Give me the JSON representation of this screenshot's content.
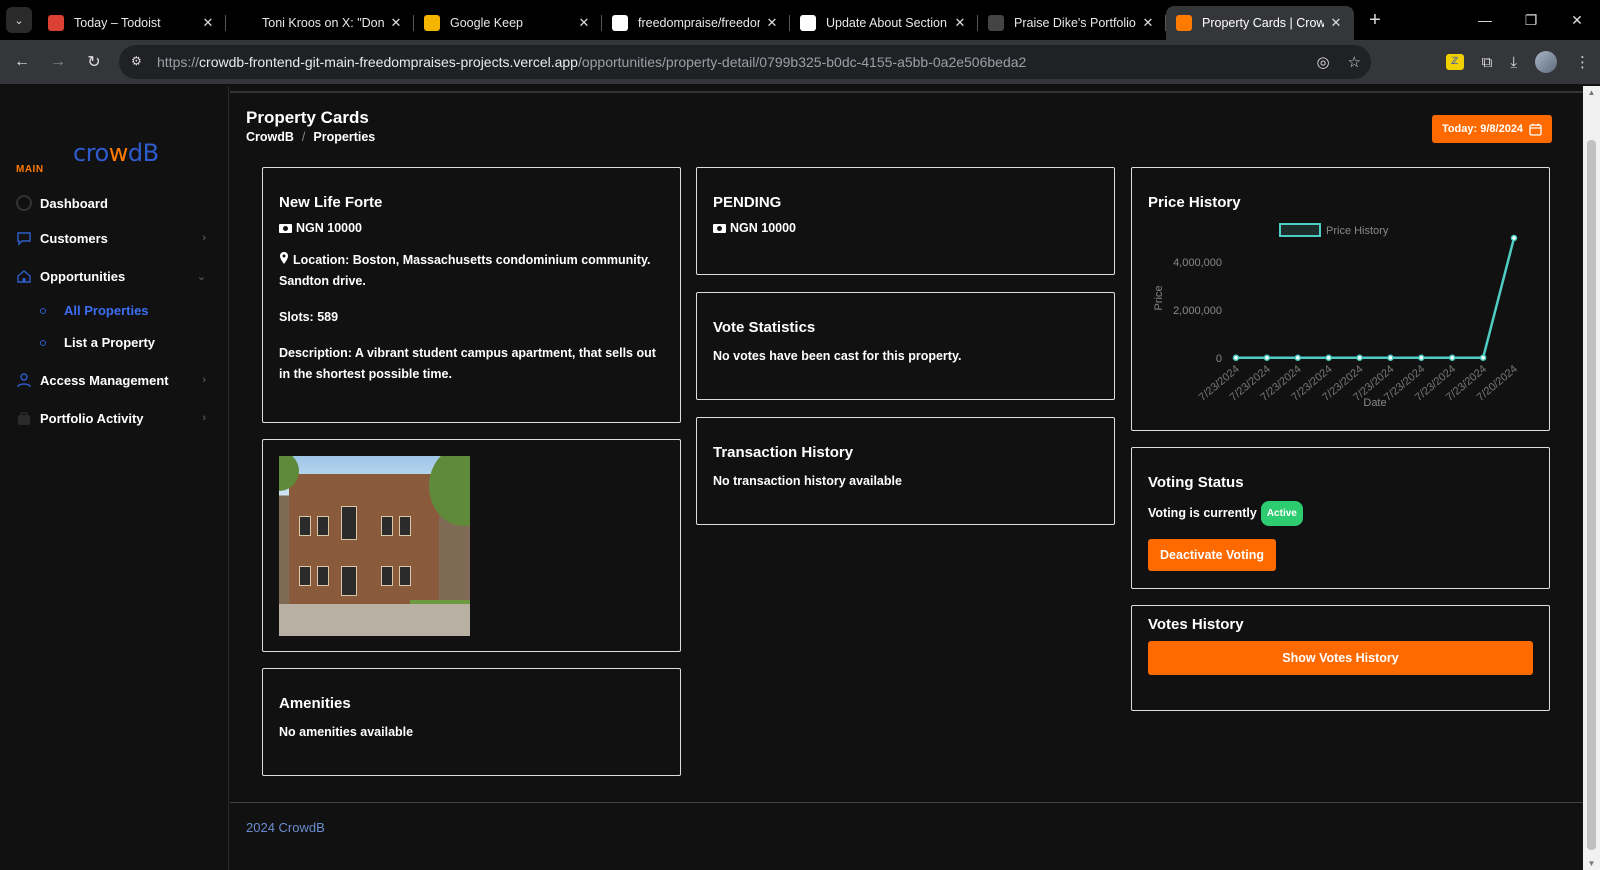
{
  "browser": {
    "tabs": [
      {
        "title": "Today – Todoist",
        "favicon_color": "#db4035",
        "favicon": "todoist-icon",
        "active": false
      },
      {
        "title": "Toni Kroos on X: \"Don't",
        "favicon_color": "#000000",
        "favicon": "x-icon",
        "active": false
      },
      {
        "title": "Google Keep",
        "favicon_color": "#f4b400",
        "favicon": "keep-icon",
        "active": false
      },
      {
        "title": "freedompraise/freedor",
        "favicon_color": "#ffffff",
        "favicon": "github-icon",
        "active": false
      },
      {
        "title": "Update About Section",
        "favicon_color": "#ffffff",
        "favicon": "chatgpt-icon",
        "active": false
      },
      {
        "title": "Praise Dike's Portfolio",
        "favicon_color": "#444444",
        "favicon": "portfolio-icon",
        "active": false
      },
      {
        "title": "Property Cards | Crowd",
        "favicon_color": "#ff7a00",
        "favicon": "crowdb-icon",
        "active": true
      }
    ],
    "url_prefix": "https://",
    "url_host": "crowdb-frontend-git-main-freedompraises-projects.vercel.app",
    "url_path": "/opportunities/property-detail/0799b325-b0dc-4155-a5bb-0a2e506beda2"
  },
  "sidebar": {
    "logo_prefix": "cro",
    "logo_w": "w",
    "logo_suffix": "dB",
    "section_label": "MAIN",
    "items": [
      {
        "label": "Dashboard",
        "icon": "dashboard-icon"
      },
      {
        "label": "Customers",
        "icon": "chat-icon"
      },
      {
        "label": "Opportunities",
        "icon": "home-icon"
      },
      {
        "label": "Access Management",
        "icon": "user-icon"
      },
      {
        "label": "Portfolio Activity",
        "icon": "bag-icon"
      }
    ],
    "sub_items": [
      {
        "label": "All Properties",
        "active": true
      },
      {
        "label": "List a Property",
        "active": false
      }
    ]
  },
  "header": {
    "title": "Property Cards",
    "breadcrumb": [
      "CrowdB",
      "Properties"
    ],
    "breadcrumb_sep": "/",
    "today_label": "Today: 9/8/2024"
  },
  "property": {
    "name": "New Life Forte",
    "price": "NGN 10000",
    "location": "Location: Boston, Massachusetts condominium community. Sandton drive.",
    "slots": "Slots: 589",
    "description": "Description: A vibrant student campus apartment, that sells out in the shortest possible time."
  },
  "amenities": {
    "title": "Amenities",
    "text": "No amenities available"
  },
  "status_card": {
    "status": "PENDING",
    "price": "NGN 10000"
  },
  "vote_statistics": {
    "title": "Vote Statistics",
    "text": "No votes have been cast for this property."
  },
  "transaction_history": {
    "title": "Transaction History",
    "text": "No transaction history available"
  },
  "price_history": {
    "title": "Price History"
  },
  "chart_data": {
    "type": "line",
    "legend": "Price History",
    "xlabel": "Date",
    "ylabel": "Price",
    "x": [
      "7/23/2024",
      "7/23/2024",
      "7/23/2024",
      "7/23/2024",
      "7/23/2024",
      "7/23/2024",
      "7/23/2024",
      "7/23/2024",
      "7/23/2024",
      "7/20/2024"
    ],
    "series": [
      {
        "name": "Price History",
        "values": [
          10000,
          10000,
          10000,
          10000,
          10000,
          10000,
          10000,
          10000,
          10000,
          5000000
        ]
      }
    ],
    "yticks": [
      "0",
      "2,000,000",
      "4,000,000"
    ],
    "ylim": [
      0,
      5000000
    ],
    "color": "#4ecdc4"
  },
  "voting_status": {
    "title": "Voting Status",
    "text": "Voting is currently",
    "badge": "Active",
    "button": "Deactivate Voting"
  },
  "votes_history": {
    "title": "Votes History",
    "button": "Show Votes History"
  },
  "footer": {
    "text": "2024 CrowdB"
  },
  "colors": {
    "accent": "#ff6a00",
    "brand_blue": "#2f5ccc",
    "success": "#2ecc71"
  }
}
